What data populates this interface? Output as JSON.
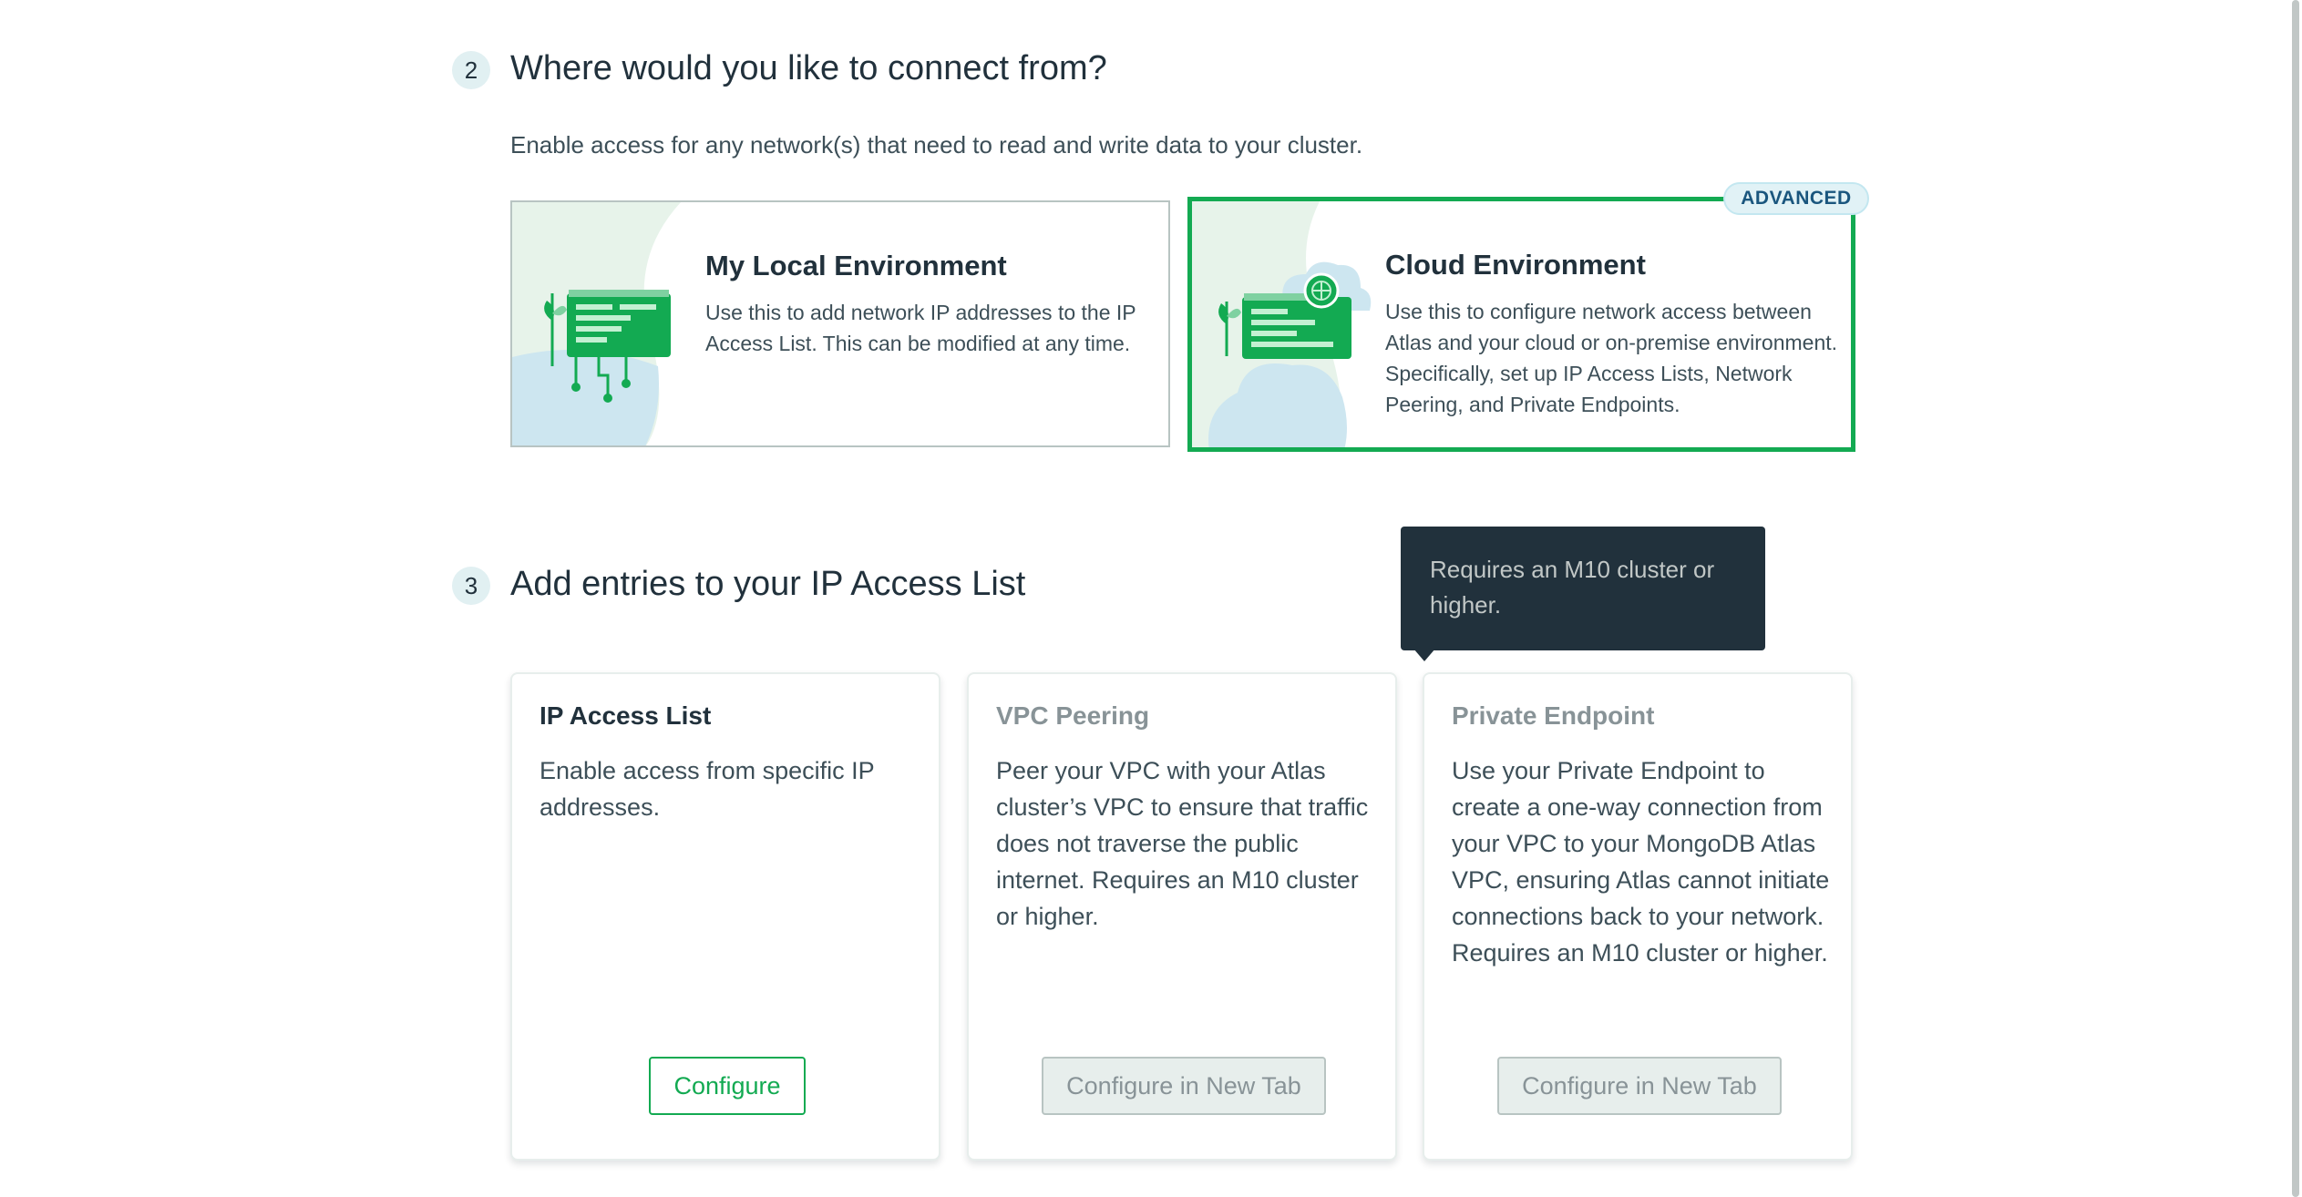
{
  "step2": {
    "number": "2",
    "heading": "Where would you like to connect from?",
    "subtext": "Enable access for any network(s) that need to read and write data to your cluster."
  },
  "local_env": {
    "title": "My Local Environment",
    "description": "Use this to add network IP addresses to the IP Access List. This can be modified at any time."
  },
  "cloud_env": {
    "badge": "ADVANCED",
    "title": "Cloud Environment",
    "description": "Use this to configure network access between Atlas and your cloud or on-premise environment. Specifically, set up IP Access Lists, Network Peering, and Private Endpoints.",
    "selected": true
  },
  "step3": {
    "number": "3",
    "heading": "Add entries to your IP Access List"
  },
  "tooltip": {
    "text": "Requires an M10 cluster or higher."
  },
  "options": [
    {
      "title": "IP Access List",
      "description": "Enable access from specific IP addresses.",
      "button": "Configure",
      "enabled": true
    },
    {
      "title": "VPC Peering",
      "description": "Peer your VPC with your Atlas cluster’s VPC to ensure that traffic does not traverse the public internet. Requires an M10 cluster or higher.",
      "button": "Configure in New Tab",
      "enabled": false
    },
    {
      "title": "Private Endpoint",
      "description": "Use your Private Endpoint to create a one-way connection from your VPC to your MongoDB Atlas VPC, ensuring Atlas cannot initiate connections back to your network. Requires an M10 cluster or higher.",
      "button": "Configure in New Tab",
      "enabled": false
    }
  ],
  "colors": {
    "accent_green": "#13aa52",
    "text_dark": "#21313c",
    "text_muted": "#889397",
    "tooltip_bg": "#21313c"
  }
}
